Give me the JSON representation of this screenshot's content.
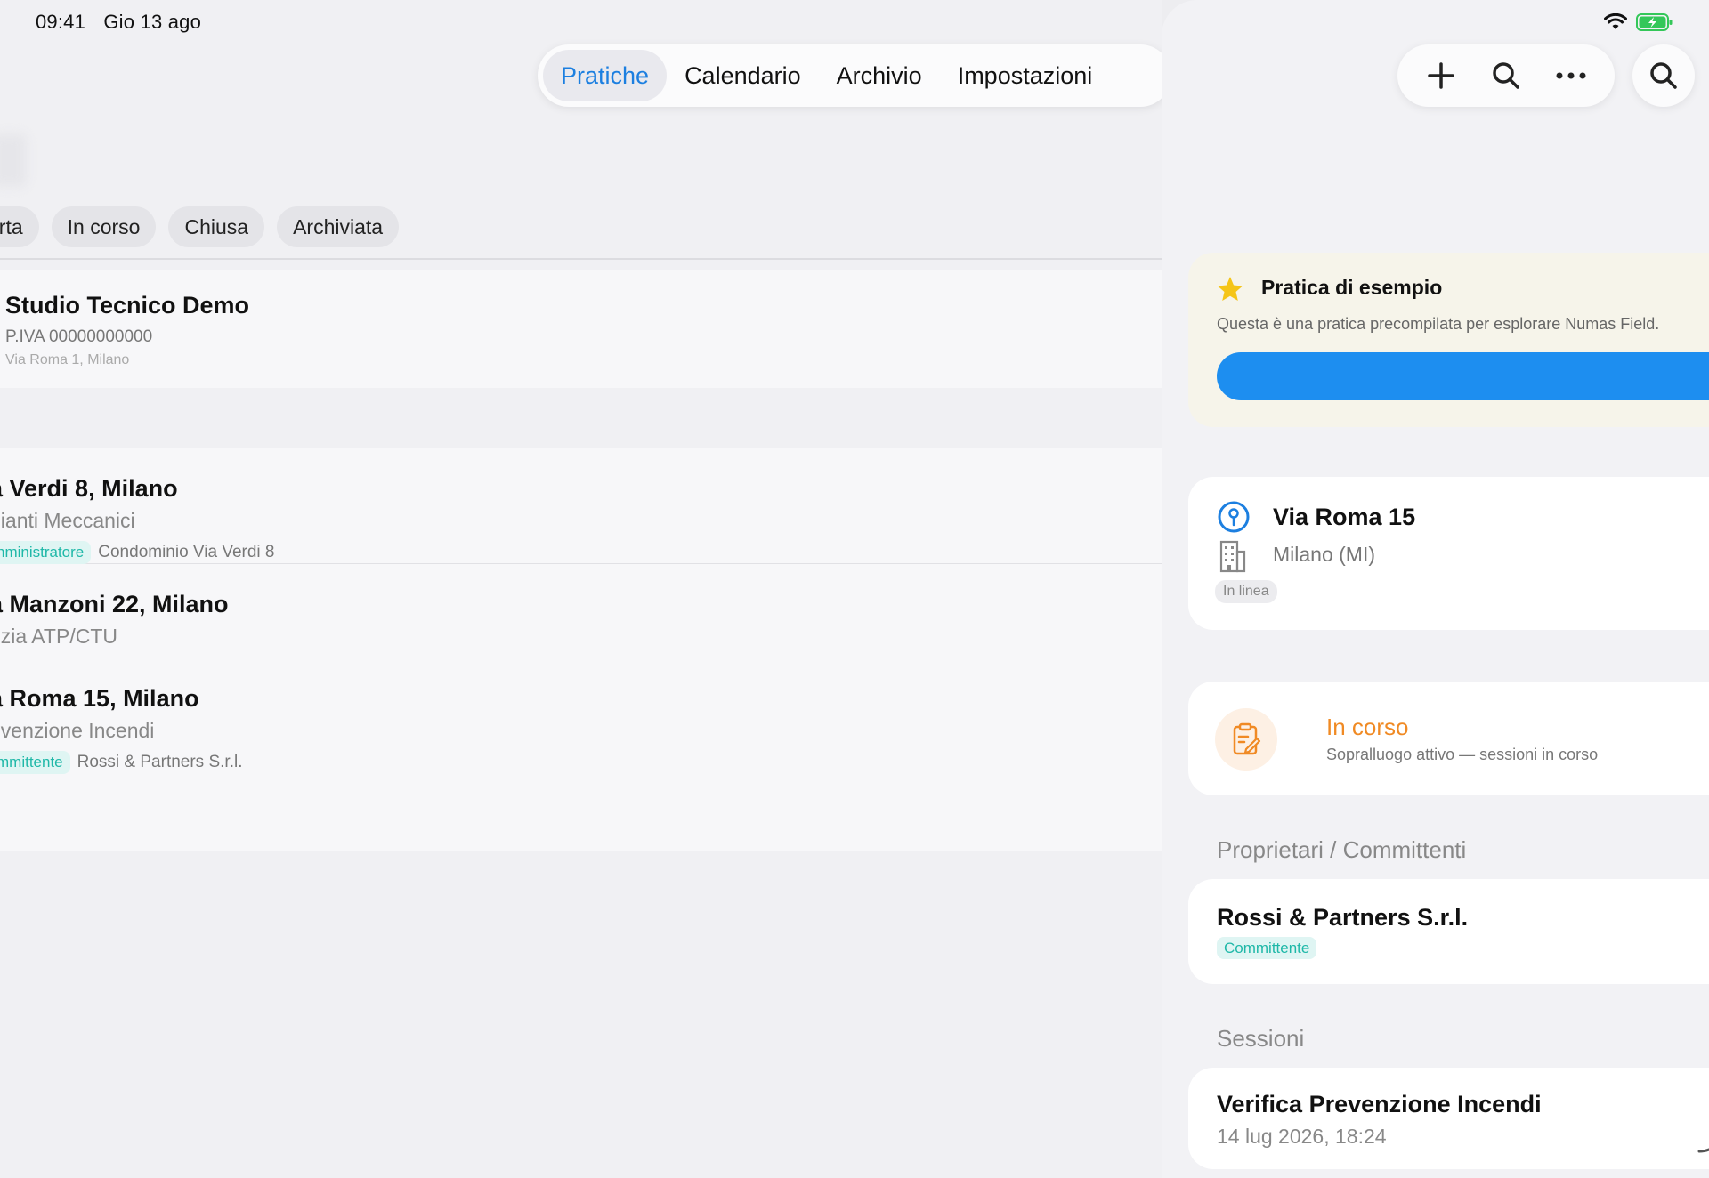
{
  "status_bar": {
    "time": "09:41",
    "date": "Gio 13 ago"
  },
  "tabs": [
    {
      "label": "Pratiche",
      "active": true
    },
    {
      "label": "Calendario",
      "active": false
    },
    {
      "label": "Archivio",
      "active": false
    },
    {
      "label": "Impostazioni",
      "active": false
    }
  ],
  "filter_chips": [
    "erta",
    "In corso",
    "Chiusa",
    "Archiviata"
  ],
  "studio": {
    "name": "Studio Tecnico Demo",
    "piva": "P.IVA 00000000000",
    "address": "Via Roma 1, Milano"
  },
  "list": [
    {
      "title": "a Verdi 8, Milano",
      "subtitle": "pianti Meccanici",
      "role": "nministratore",
      "client": "Condominio Via Verdi 8"
    },
    {
      "title": "a Manzoni 22, Milano",
      "subtitle": "rizia ATP/CTU",
      "role": "",
      "client": ""
    },
    {
      "title": "a Roma 15, Milano",
      "subtitle": "evenzione Incendi",
      "role": "mmittente",
      "client": "Rossi & Partners S.r.l."
    }
  ],
  "detail": {
    "example": {
      "title": "Pratica di esempio",
      "description": "Questa è una pratica precompilata per esplorare Numas Field."
    },
    "address": {
      "street": "Via Roma 15",
      "city": "Milano (MI)",
      "badge": "In linea"
    },
    "status": {
      "label": "In corso",
      "description": "Sopralluogo attivo — sessioni in corso"
    },
    "owners_section": "Proprietari / Committenti",
    "owner": {
      "name": "Rossi & Partners S.r.l.",
      "role": "Committente"
    },
    "sessions_section": "Sessioni",
    "session": {
      "title": "Verifica Prevenzione Incendi",
      "date": "14 lug 2026, 18:24"
    }
  },
  "icons": {
    "add": "plus-icon",
    "search": "search-icon",
    "more": "ellipsis-icon",
    "search_round": "search-icon",
    "wifi": "wifi-icon",
    "battery": "battery-charging-icon",
    "star": "star-icon",
    "pin": "map-pin-icon",
    "building": "building-icon",
    "clipboard": "clipboard-edit-icon"
  },
  "colors": {
    "accent": "#1c7fe0",
    "progress_bar": "#1d8ef0",
    "status_orange": "#f08a24",
    "teal_tag": "#1fb8a8",
    "star": "#f5c518",
    "battery": "#34c759"
  }
}
